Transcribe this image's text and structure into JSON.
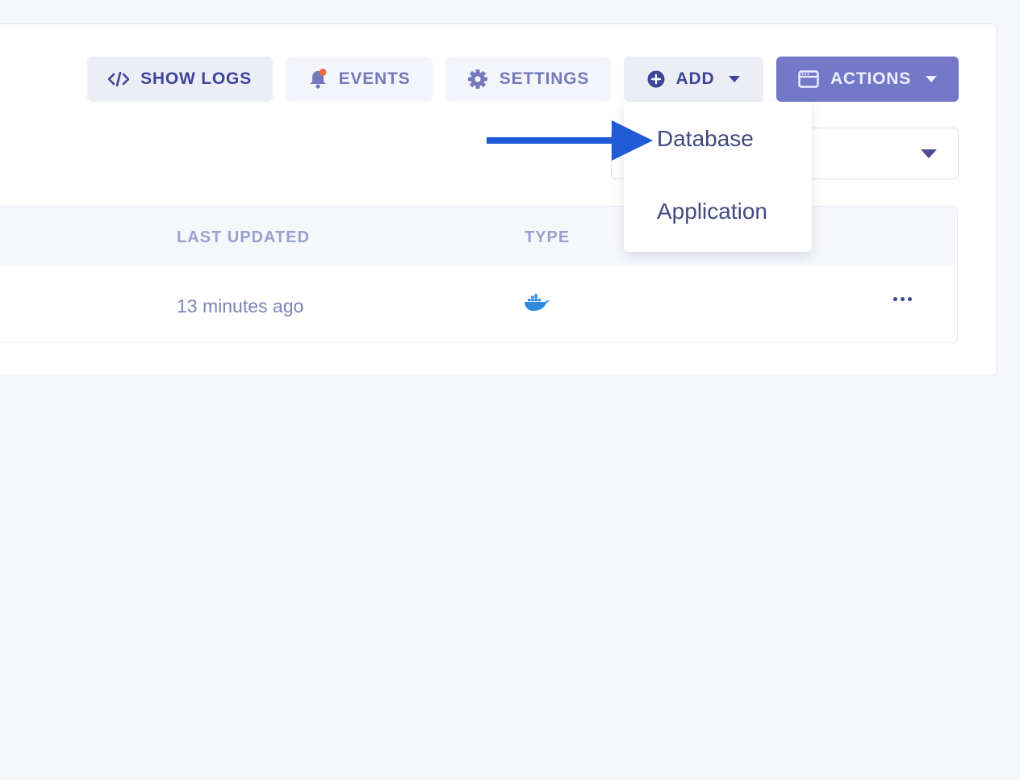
{
  "toolbar": {
    "show_logs_label": "SHOW LOGS",
    "events_label": "EVENTS",
    "settings_label": "SETTINGS",
    "add_label": "ADD",
    "actions_label": "ACTIONS"
  },
  "add_menu": {
    "items": [
      {
        "label": "Database"
      },
      {
        "label": "Application"
      }
    ]
  },
  "table": {
    "columns": {
      "last_updated": "LAST UPDATED",
      "type": "TYPE"
    },
    "rows": [
      {
        "last_updated": "13 minutes ago",
        "type_icon": "docker-icon"
      }
    ]
  },
  "colors": {
    "accent": "#7378c9",
    "primary_text": "#3e4499",
    "notification_dot": "#e8684a",
    "docker_blue": "#2f8cdc",
    "annotation_arrow": "#1f5bd6"
  }
}
